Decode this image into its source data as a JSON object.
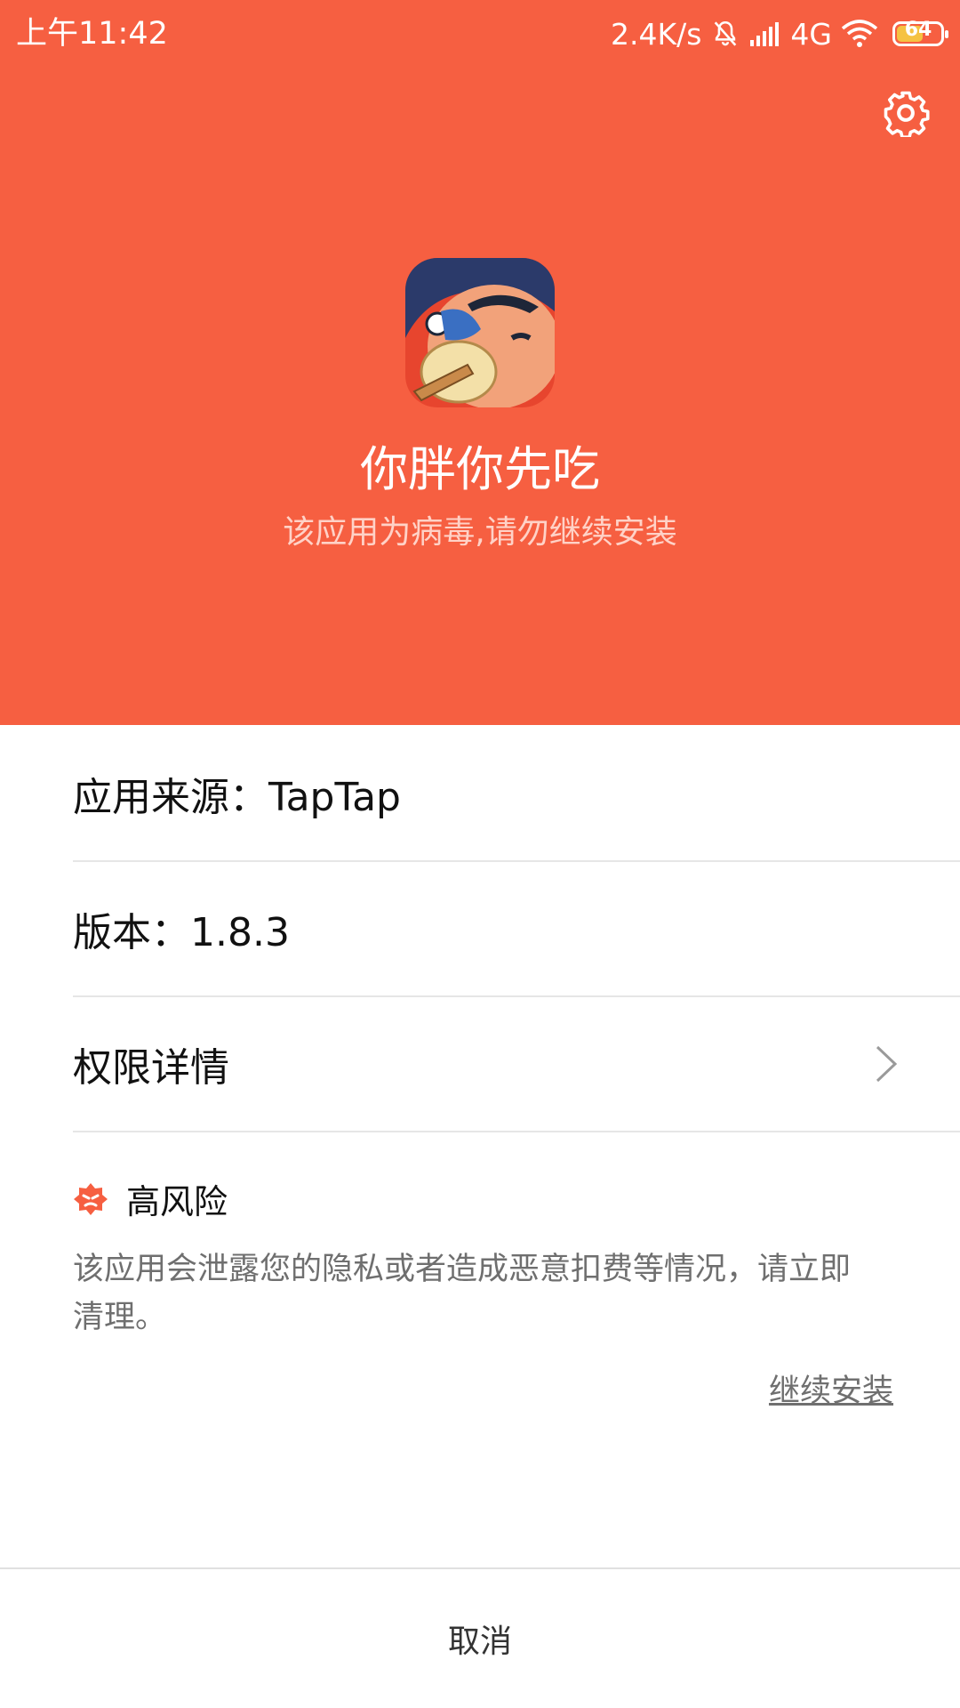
{
  "status_bar": {
    "time": "上午11:42",
    "net_speed": "2.4K/s",
    "network": "4G",
    "battery": "64",
    "battery_level": 0.64
  },
  "header": {
    "bg_color": "#F65F41",
    "app_name": "你胖你先吃",
    "warning": "该应用为病毒,请勿继续安装"
  },
  "details": {
    "source": "应用来源：TapTap",
    "version": "版本：1.8.3",
    "permissions": "权限详情"
  },
  "risk": {
    "title": "高风险",
    "description": "该应用会泄露您的隐私或者造成恶意扣费等情况，请立即清理。",
    "continue_label": "继续安装"
  },
  "footer": {
    "cancel_label": "取消"
  }
}
